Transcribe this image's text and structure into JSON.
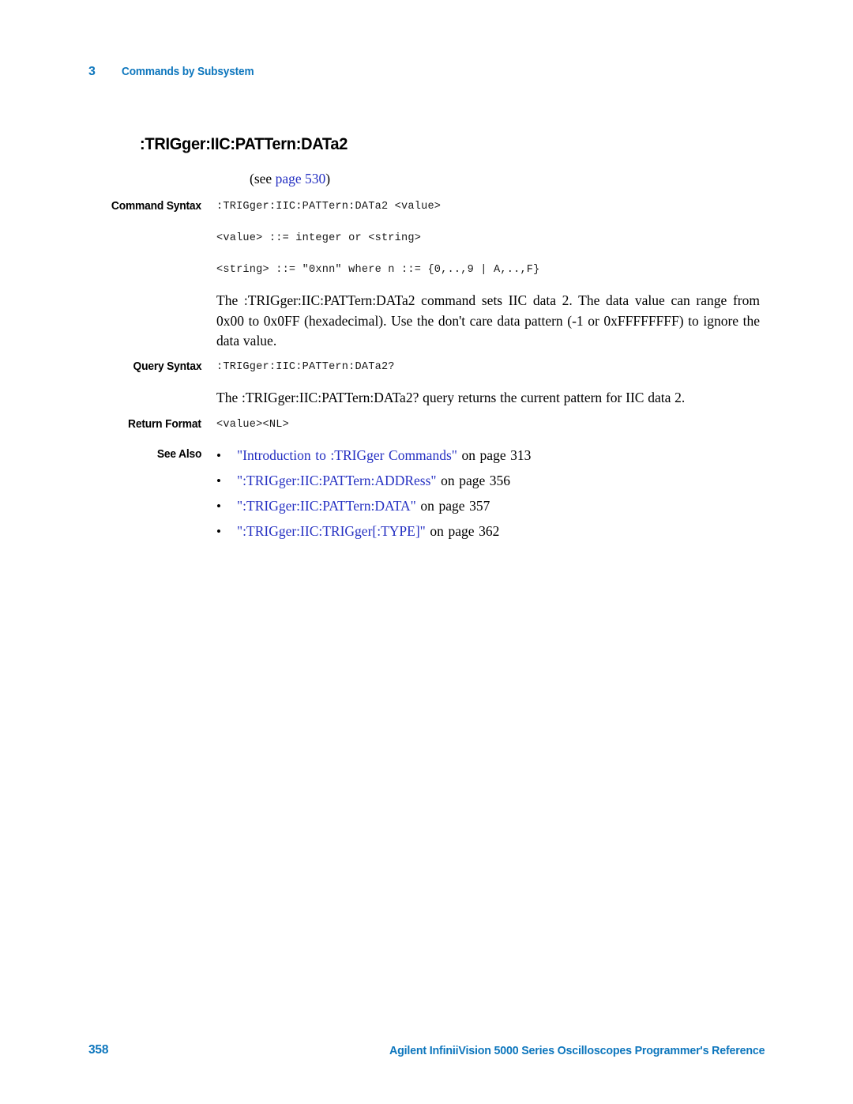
{
  "header": {
    "chapter_number": "3",
    "chapter_title": "Commands by Subsystem"
  },
  "command": {
    "title": ":TRIGger:IIC:PATTern:DATa2",
    "see_reference": {
      "prefix": "(see ",
      "link_text": "page 530",
      "suffix": ")"
    },
    "sections": {
      "command_syntax_label": "Command Syntax",
      "query_syntax_label": "Query Syntax",
      "return_format_label": "Return Format",
      "see_also_label": "See Also"
    },
    "command_syntax_lines": [
      ":TRIGger:IIC:PATTern:DATa2 <value>",
      "<value> ::= integer or <string>",
      "<string> ::= \"0xnn\" where n ::= {0,..,9 | A,..,F}"
    ],
    "command_description": "The :TRIGger:IIC:PATTern:DATa2 command sets IIC data 2. The data value can range from 0x00 to 0x0FF (hexadecimal). Use the don't care data pattern (-1 or 0xFFFFFFFF) to ignore the data value.",
    "query_syntax": ":TRIGger:IIC:PATTern:DATa2?",
    "query_description": "The :TRIGger:IIC:PATTern:DATa2? query returns the current pattern for IIC data 2.",
    "return_format": "<value><NL>",
    "see_also": [
      {
        "bullet": "•",
        "link": "\"Introduction to :TRIGger Commands\"",
        "tail": "on page 313"
      },
      {
        "bullet": "•",
        "link": "\":TRIGger:IIC:PATTern:ADDRess\"",
        "tail": "on page 356"
      },
      {
        "bullet": "•",
        "link": "\":TRIGger:IIC:PATTern:DATA\"",
        "tail": "on page 357"
      },
      {
        "bullet": "•",
        "link": "\":TRIGger:IIC:TRIGger[:TYPE]\"",
        "tail": "on page 362"
      }
    ]
  },
  "footer": {
    "page_number": "358",
    "document_title": "Agilent InfiniiVision 5000 Series Oscilloscopes Programmer's Reference"
  },
  "colors": {
    "brand_blue": "#0d76bd",
    "link_blue": "#2530c2",
    "text_black": "#000000",
    "page_background": "#ffffff"
  }
}
